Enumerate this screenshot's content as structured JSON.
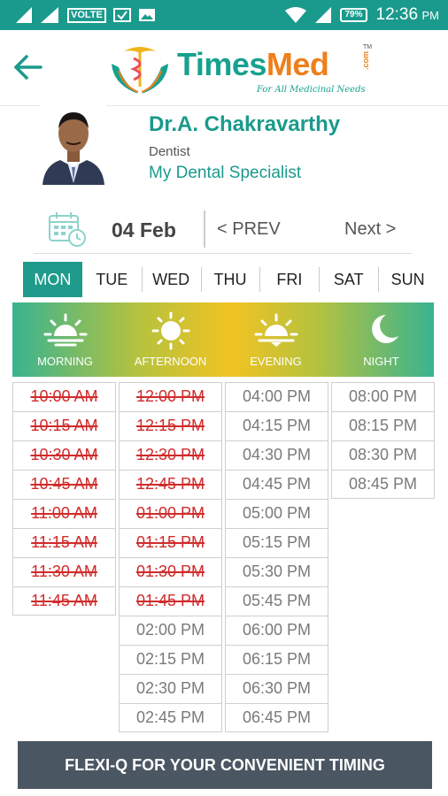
{
  "status_bar": {
    "network_label": "VOLTE",
    "battery": "79%",
    "time": "12:36",
    "ampm": "PM"
  },
  "header": {
    "brand_part1": "Times",
    "brand_part2": "Med",
    "brand_com": ".com",
    "brand_tm": "TM",
    "tagline": "For All Medicinal Needs"
  },
  "doctor": {
    "name": "Dr.A. Chakravarthy",
    "specialty": "Dentist",
    "clinic": "My Dental Specialist"
  },
  "date_nav": {
    "date": "04 Feb",
    "prev": "< PREV",
    "next": "Next >"
  },
  "days": [
    "MON",
    "TUE",
    "WED",
    "THU",
    "FRI",
    "SAT",
    "SUN"
  ],
  "active_day": "MON",
  "periods": [
    "MORNING",
    "AFTERNOON",
    "EVENING",
    "NIGHT"
  ],
  "slots": {
    "morning": [
      {
        "time": "10:00 AM",
        "booked": true
      },
      {
        "time": "10:15 AM",
        "booked": true
      },
      {
        "time": "10:30 AM",
        "booked": true
      },
      {
        "time": "10:45 AM",
        "booked": true
      },
      {
        "time": "11:00 AM",
        "booked": true
      },
      {
        "time": "11:15 AM",
        "booked": true
      },
      {
        "time": "11:30 AM",
        "booked": true
      },
      {
        "time": "11:45 AM",
        "booked": true
      }
    ],
    "afternoon": [
      {
        "time": "12:00 PM",
        "booked": true
      },
      {
        "time": "12:15 PM",
        "booked": true
      },
      {
        "time": "12:30 PM",
        "booked": true
      },
      {
        "time": "12:45 PM",
        "booked": true
      },
      {
        "time": "01:00 PM",
        "booked": true
      },
      {
        "time": "01:15 PM",
        "booked": true
      },
      {
        "time": "01:30 PM",
        "booked": true
      },
      {
        "time": "01:45 PM",
        "booked": true
      },
      {
        "time": "02:00 PM",
        "booked": false
      },
      {
        "time": "02:15 PM",
        "booked": false
      },
      {
        "time": "02:30 PM",
        "booked": false
      },
      {
        "time": "02:45 PM",
        "booked": false
      }
    ],
    "evening": [
      {
        "time": "04:00 PM",
        "booked": false
      },
      {
        "time": "04:15 PM",
        "booked": false
      },
      {
        "time": "04:30 PM",
        "booked": false
      },
      {
        "time": "04:45 PM",
        "booked": false
      },
      {
        "time": "05:00 PM",
        "booked": false
      },
      {
        "time": "05:15 PM",
        "booked": false
      },
      {
        "time": "05:30 PM",
        "booked": false
      },
      {
        "time": "05:45 PM",
        "booked": false
      },
      {
        "time": "06:00 PM",
        "booked": false
      },
      {
        "time": "06:15 PM",
        "booked": false
      },
      {
        "time": "06:30 PM",
        "booked": false
      },
      {
        "time": "06:45 PM",
        "booked": false
      }
    ],
    "night": [
      {
        "time": "08:00 PM",
        "booked": false
      },
      {
        "time": "08:15 PM",
        "booked": false
      },
      {
        "time": "08:30 PM",
        "booked": false
      },
      {
        "time": "08:45 PM",
        "booked": false
      }
    ]
  },
  "footer": {
    "flexi_label": "FLEXI-Q FOR YOUR CONVENIENT TIMING"
  },
  "colors": {
    "status_bar": "#1a9a8c",
    "brand_teal": "#17a18f",
    "brand_orange": "#ef7f1a",
    "booked_red": "#d12b2b",
    "footer_bg": "#4a5661"
  }
}
